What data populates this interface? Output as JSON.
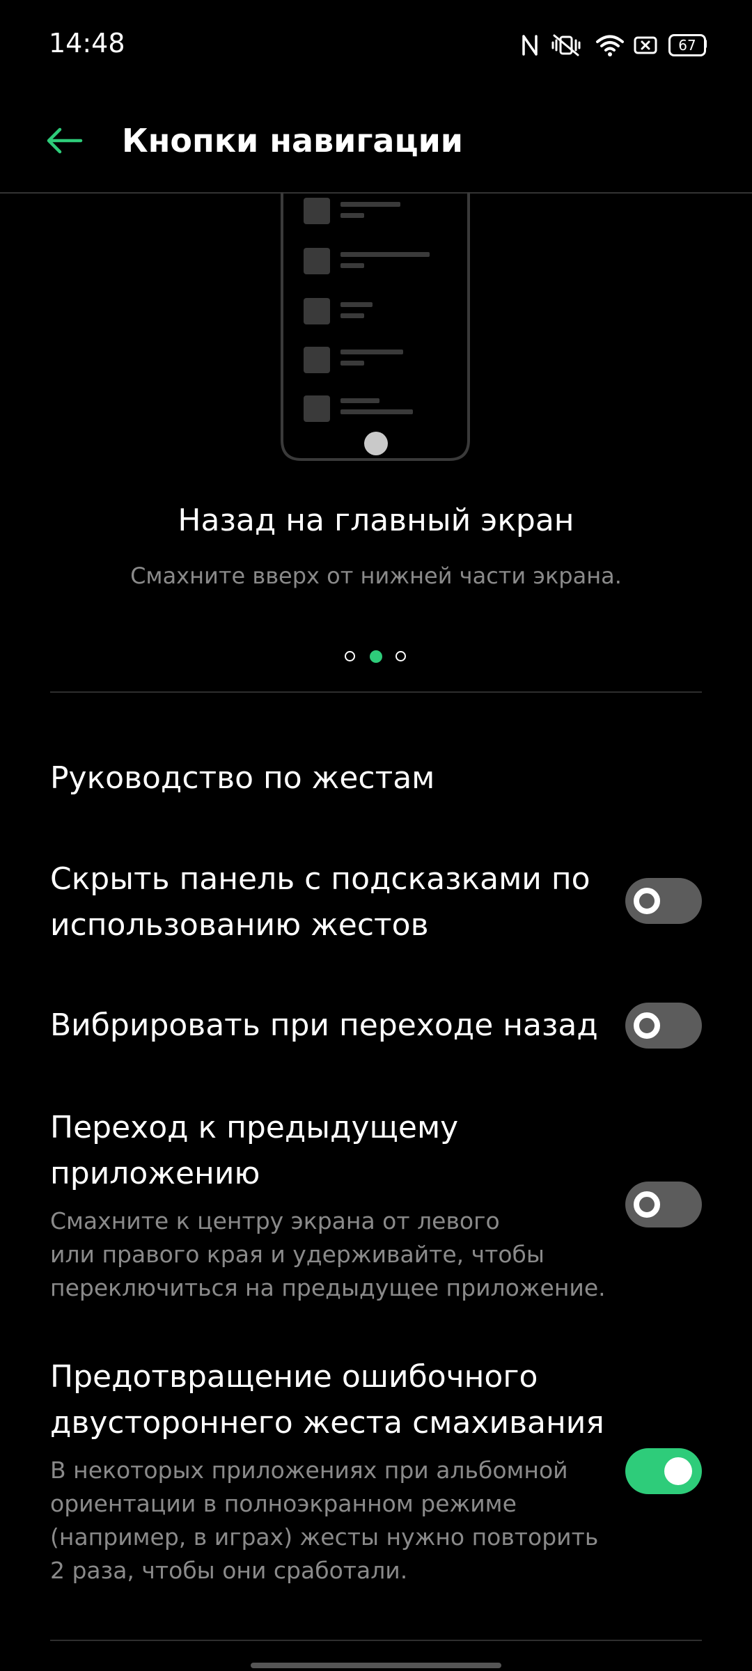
{
  "status_bar": {
    "time": "14:48",
    "icons": [
      "nfc-icon",
      "vibrate-mute-icon",
      "wifi-icon",
      "screenshot-icon",
      "battery-icon"
    ],
    "battery_level": "67"
  },
  "header": {
    "title": "Кнопки навигации",
    "back_icon": "arrow-left-icon",
    "accent_color": "#2ecc7a"
  },
  "carousel": {
    "title": "Назад на главный экран",
    "subtitle": "Смахните вверх от нижней части экрана.",
    "page_count": 3,
    "active_page": 2
  },
  "settings": {
    "gesture_guide": {
      "title": "Руководство по жестам"
    },
    "hide_hint_panel": {
      "title_line1": "Скрыть панель с подсказками по",
      "title_line2": "использованию жестов",
      "enabled": false
    },
    "vibrate_on_back": {
      "title": "Вибрировать при переходе назад",
      "enabled": false
    },
    "switch_to_previous_app": {
      "title_line1": "Переход к предыдущему",
      "title_line2": "приложению",
      "desc_line1": "Смахните к центру экрана от левого",
      "desc_line2": "или правого края и удерживайте, чтобы",
      "desc_line3": "переключиться на предыдущее приложение.",
      "enabled": false
    },
    "prevent_double_swipe": {
      "title_line1": "Предотвращение ошибочного",
      "title_line2": "двустороннего жеста смахивания",
      "desc_line1": "В некоторых приложениях при альбомной",
      "desc_line2": "ориентации в полноэкранном режиме",
      "desc_line3": "(например, в играх) жесты нужно повторить",
      "desc_line4": "2 раза, чтобы они сработали.",
      "enabled": true
    }
  }
}
